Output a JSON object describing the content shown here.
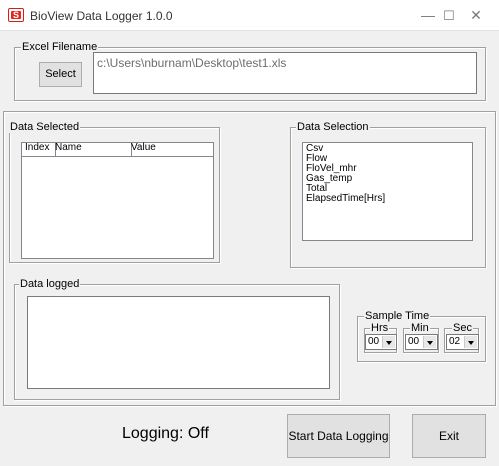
{
  "window": {
    "title": "BioView Data Logger 1.0.0",
    "icon_letter": "S",
    "minimize_glyph": "—",
    "maximize_glyph": "☐",
    "close_glyph": "✕"
  },
  "excel": {
    "legend": "Excel Filename",
    "select_label": "Select",
    "path_value": "c:\\Users\\nburnam\\Desktop\\test1.xls"
  },
  "data_selected": {
    "legend": "Data Selected",
    "columns": [
      "Index",
      "Name",
      "Value"
    ],
    "rows": []
  },
  "data_selection": {
    "legend": "Data Selection",
    "items": [
      "Csv",
      "Flow",
      "FloVel_mhr",
      "Gas_temp",
      "Total",
      "ElapsedTime[Hrs]"
    ]
  },
  "data_logged": {
    "legend": "Data logged",
    "value": ""
  },
  "sample_time": {
    "legend": "Sample Time",
    "hrs_label": "Hrs",
    "min_label": "Min",
    "sec_label": "Sec",
    "hrs_value": "00",
    "min_value": "00",
    "sec_value": "02"
  },
  "footer": {
    "status_text": "Logging: Off",
    "start_label": "Start Data Logging",
    "exit_label": "Exit"
  },
  "colors": {
    "window_bg": "#f0f0f0",
    "titlebar_bg": "#ffffff",
    "icon_red": "#e5261f"
  }
}
